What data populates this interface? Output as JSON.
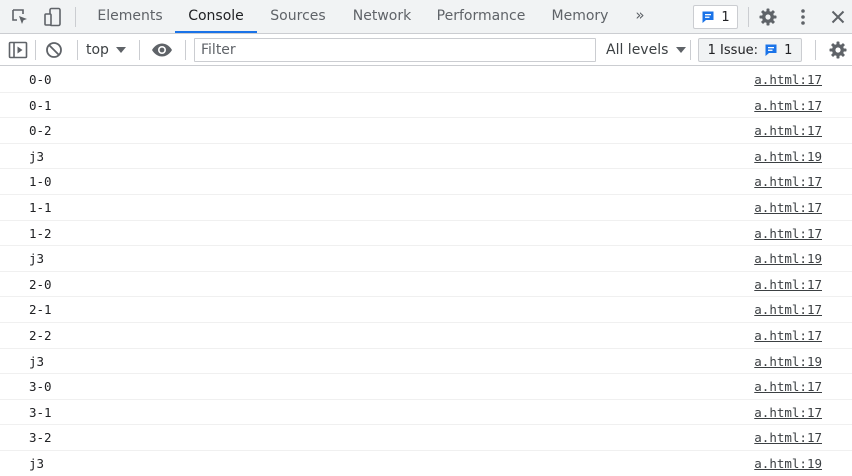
{
  "tabbar": {
    "tabs": [
      {
        "label": "Elements",
        "active": false
      },
      {
        "label": "Console",
        "active": true
      },
      {
        "label": "Sources",
        "active": false
      },
      {
        "label": "Network",
        "active": false
      },
      {
        "label": "Performance",
        "active": false
      },
      {
        "label": "Memory",
        "active": false
      }
    ],
    "more_tabs_glyph": "»",
    "messages_count": "1",
    "icons": {
      "inspect": "inspect-element-icon",
      "device": "device-toolbar-icon",
      "messages": "messages-icon",
      "settings": "gear-icon",
      "menu": "vertical-dots-icon",
      "close": "close-icon"
    }
  },
  "toolbar": {
    "context_label": "top",
    "filter_value": "",
    "filter_placeholder": "Filter",
    "levels_label": "All levels",
    "issues_label": "1 Issue:",
    "issues_count": "1",
    "icons": {
      "sidebar": "show-sidebar-icon",
      "clear": "clear-console-icon",
      "context_dropdown": "caret-down-icon",
      "live_expression": "eye-icon",
      "levels_dropdown": "caret-down-icon",
      "issues": "messages-icon",
      "settings": "gear-icon"
    }
  },
  "colors": {
    "accent": "#1a73e8",
    "icon": "#5f6368",
    "bar_background": "#f1f3f4"
  },
  "messages": [
    {
      "text": "0-0",
      "source": "a.html:17"
    },
    {
      "text": "0-1",
      "source": "a.html:17"
    },
    {
      "text": "0-2",
      "source": "a.html:17"
    },
    {
      "text": "j3",
      "source": "a.html:19"
    },
    {
      "text": "1-0",
      "source": "a.html:17"
    },
    {
      "text": "1-1",
      "source": "a.html:17"
    },
    {
      "text": "1-2",
      "source": "a.html:17"
    },
    {
      "text": "j3",
      "source": "a.html:19"
    },
    {
      "text": "2-0",
      "source": "a.html:17"
    },
    {
      "text": "2-1",
      "source": "a.html:17"
    },
    {
      "text": "2-2",
      "source": "a.html:17"
    },
    {
      "text": "j3",
      "source": "a.html:19"
    },
    {
      "text": "3-0",
      "source": "a.html:17"
    },
    {
      "text": "3-1",
      "source": "a.html:17"
    },
    {
      "text": "3-2",
      "source": "a.html:17"
    },
    {
      "text": "j3",
      "source": "a.html:19"
    }
  ]
}
